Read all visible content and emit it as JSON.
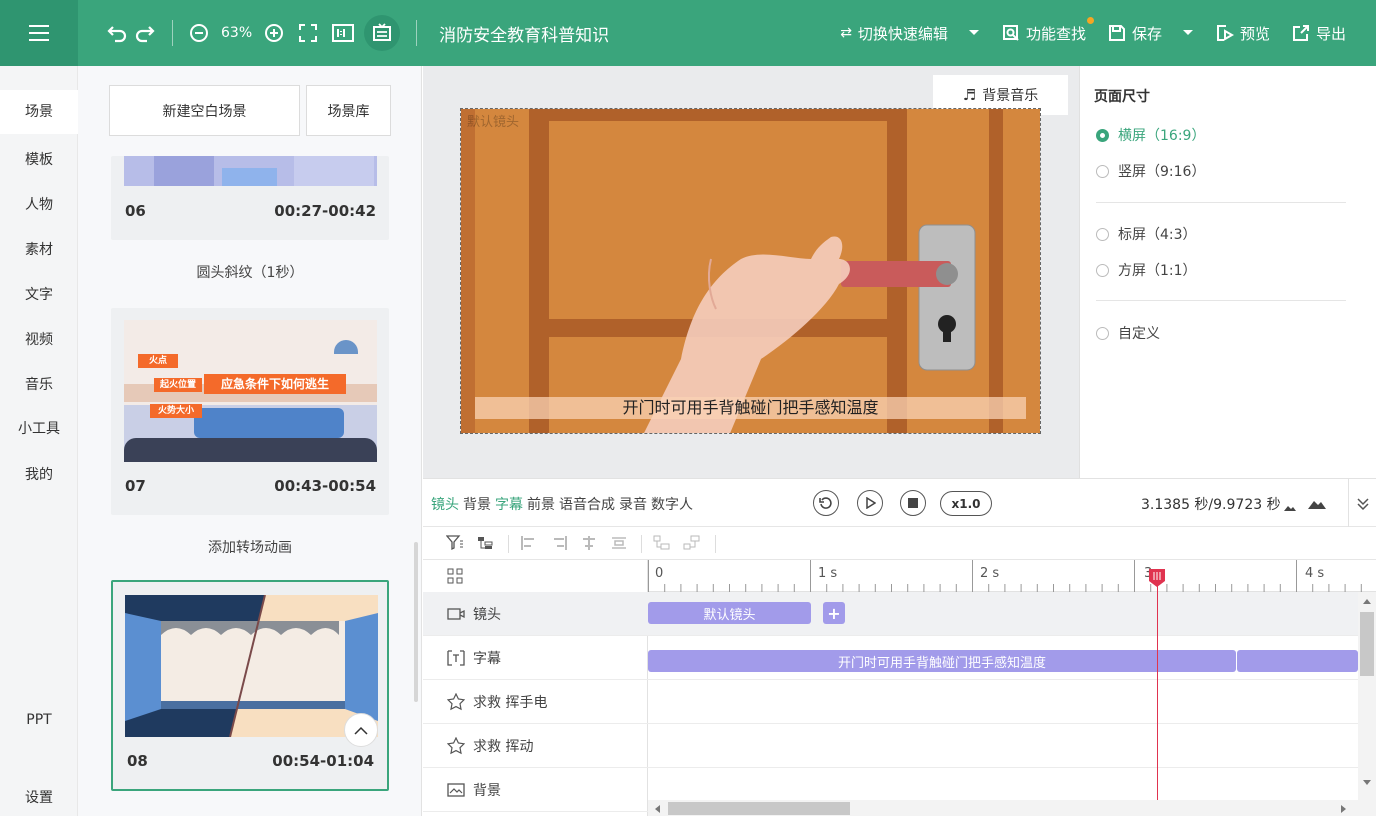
{
  "header": {
    "zoom": "63%",
    "doc_title": "消防安全教育科普知识",
    "switch_edit": "切换快速编辑",
    "feature_search": "功能查找",
    "save": "保存",
    "preview": "预览",
    "export": "导出"
  },
  "leftnav": {
    "items": [
      "场景",
      "模板",
      "人物",
      "素材",
      "文字",
      "视频",
      "音乐",
      "小工具",
      "我的"
    ],
    "ppt": "PPT",
    "settings": "设置"
  },
  "scene_panel": {
    "new_blank": "新建空白场景",
    "library": "场景库",
    "scenes": [
      {
        "num": "06",
        "time": "00:27-00:42"
      },
      {
        "num": "07",
        "time": "00:43-00:54"
      },
      {
        "num": "08",
        "time": "00:54-01:04"
      }
    ],
    "transition_1": "圆头斜纹（1秒）",
    "transition_2": "添加转场动画",
    "thumb07": {
      "tag1": "火点",
      "tag2": "起火位置",
      "banner": "应急条件下如何逃生",
      "tag3": "火势大小"
    }
  },
  "canvas": {
    "bg_music": "背景音乐",
    "watermark": "默认镜头",
    "subtitle": "开门时可用手背触碰门把手感知温度"
  },
  "props": {
    "title": "页面尺寸",
    "options": [
      "横屏（16:9）",
      "竖屏（9:16）",
      "标屏（4:3）",
      "方屏（1:1）",
      "自定义"
    ],
    "selected_index": 0
  },
  "timeline": {
    "tabs": [
      "镜头",
      "背景",
      "字幕",
      "前景",
      "语音合成",
      "录音",
      "数字人"
    ],
    "speed": "x1.0",
    "time": "3.1385 秒/9.9723 秒",
    "ruler": [
      "0",
      "1 s",
      "2 s",
      "3",
      "4 s"
    ],
    "tracks": [
      "镜头",
      "字幕",
      "求救 挥手电",
      "求救 挥动",
      "背景"
    ],
    "clips": {
      "camera": "默认镜头",
      "subtitle": "开门时可用手背触碰门把手感知温度"
    }
  },
  "colors": {
    "accent": "#3aa57c",
    "clip": "#a29bea",
    "playhead": "#e0334f",
    "door": "#d4873e"
  }
}
